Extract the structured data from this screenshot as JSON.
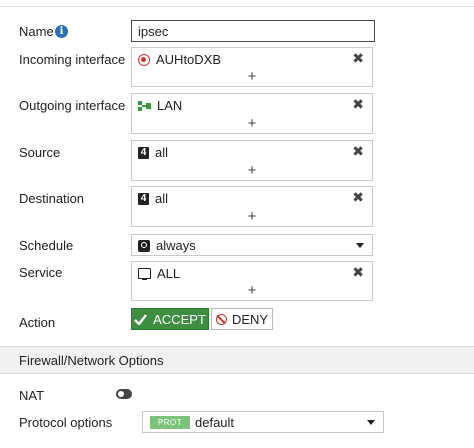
{
  "form": {
    "name": {
      "label": "Name",
      "value": "ipsec"
    },
    "incoming_interface": {
      "label": "Incoming interface",
      "entry": "AUHtoDXB",
      "entry_icon": "site-to-site-vpn-icon",
      "add": "+",
      "remove": "✖"
    },
    "outgoing_interface": {
      "label": "Outgoing interface",
      "entry": "LAN",
      "entry_icon": "lan-icon",
      "add": "+",
      "remove": "✖"
    },
    "source": {
      "label": "Source",
      "entry": "all",
      "entry_icon": "ipv4-address-icon",
      "add": "+",
      "remove": "✖"
    },
    "destination": {
      "label": "Destination",
      "entry": "all",
      "entry_icon": "ipv4-address-icon",
      "add": "+",
      "remove": "✖"
    },
    "schedule": {
      "label": "Schedule",
      "value": "always",
      "icon": "schedule-clock-icon"
    },
    "service": {
      "label": "Service",
      "entry": "ALL",
      "entry_icon": "service-icon",
      "add": "+",
      "remove": "✖"
    },
    "action": {
      "label": "Action",
      "accept_label": "ACCEPT",
      "deny_label": "DENY",
      "selected": "ACCEPT"
    }
  },
  "section": {
    "title": "Firewall/Network Options"
  },
  "nat": {
    "label": "NAT",
    "enabled": false
  },
  "protocol_options": {
    "label": "Protocol options",
    "badge": "PROT",
    "value": "default"
  },
  "colors": {
    "accept": "#3e8e41",
    "deny": "#cc3333",
    "info": "#2d6fb4",
    "badge": "#7cc47a"
  }
}
